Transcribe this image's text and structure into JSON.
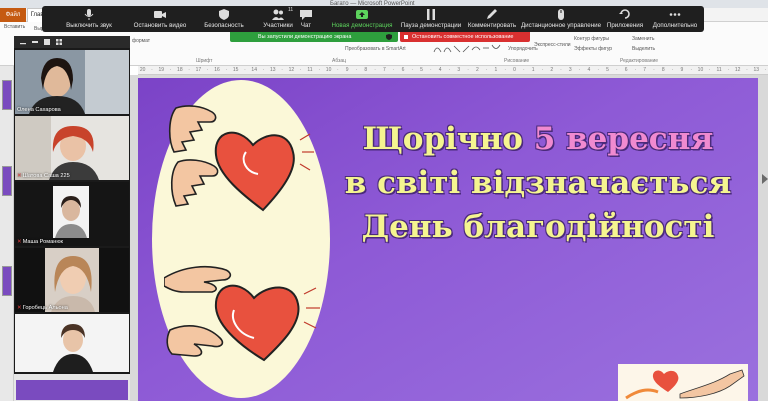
{
  "app": {
    "window_title": "Багато — Microsoft PowerPoint"
  },
  "ribbon": {
    "file_tab": "Файл",
    "home_tab": "Главная",
    "cut": "Вырезать",
    "paste": "Вставить",
    "format": "формат",
    "font_group": "Шрифт",
    "paragraph_group": "Абзац",
    "drawing_group": "Рисование",
    "editing_group": "Редактирование",
    "convert_smartart": "Преобразовать в SmartArt",
    "arrange": "Упорядочить",
    "quick_styles": "Экспресс-стили",
    "shape_outline": "Контур фигуры",
    "shape_effects": "Эффекты фигур",
    "replace": "Заменить",
    "select": "Выделить"
  },
  "zoom_toolbar": {
    "mute": "Выключить звук",
    "stop_video": "Остановить видео",
    "security": "Безопасность",
    "participants": "Участники",
    "participants_count": "11",
    "chat": "Чат",
    "new_share": "Новая демонстрация",
    "pause_share": "Пауза демонстрации",
    "annotate": "Комментировать",
    "remote_control": "Дистанционное управление",
    "apps": "Приложения",
    "more": "Дополнительно",
    "sharing_banner": "Вы запустили демонстрацию экрана",
    "stop_share": "Остановить совместное использование"
  },
  "participants": [
    {
      "name": "Олена Сахарова",
      "muted": false
    },
    {
      "name": "Шатова Саша 225",
      "muted": true
    },
    {
      "name": "Маша Романюк",
      "muted": true
    },
    {
      "name": "Горобець Альона",
      "muted": true
    },
    {
      "name": "",
      "muted": false
    }
  ],
  "slide": {
    "line1_a": "Щорічно ",
    "line1_b": "5 вересня",
    "line2": "в світі відзначається",
    "line3": "День благодійності"
  },
  "colors": {
    "slide_purple": "#8e5ad6",
    "title_yellow": "#f5f590",
    "accent_pink": "#f08ad0",
    "zoom_green": "#5dd35d",
    "stop_red": "#d93030",
    "heart": "#e8513e"
  }
}
